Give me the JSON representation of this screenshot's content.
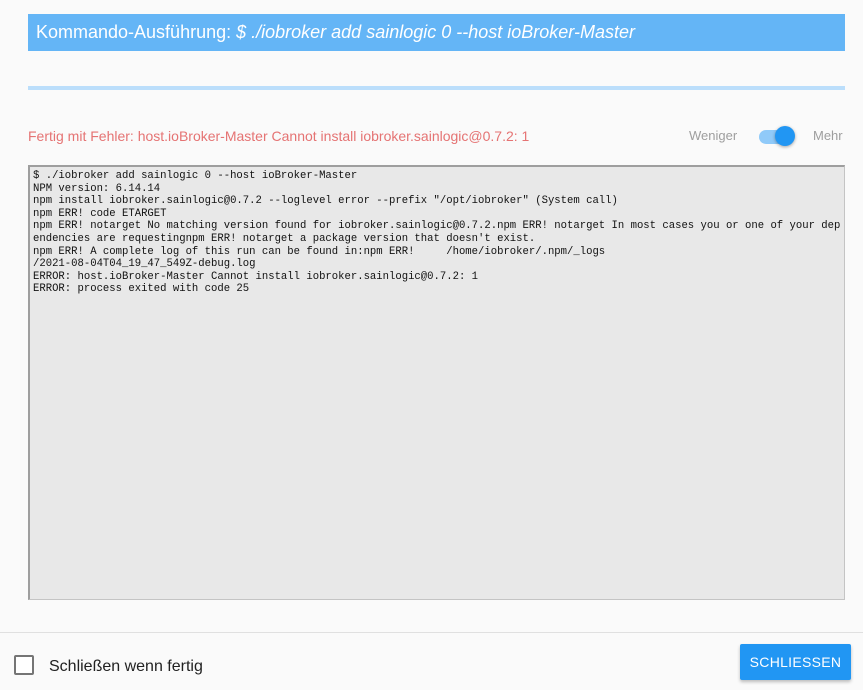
{
  "dialog": {
    "title_prefix": "Kommando-Ausführung: ",
    "title_command": "$ ./iobroker add sainlogic 0 --host ioBroker-Master",
    "progress": 1.0,
    "status": "Fertig mit Fehler: host.ioBroker-Master Cannot install iobroker.sainlogic@0.7.2: 1",
    "toggle": {
      "less_label": "Weniger",
      "more_label": "Mehr",
      "on": true
    },
    "log_lines": [
      "$ ./iobroker add sainlogic 0 --host ioBroker-Master",
      "NPM version: 6.14.14",
      "npm install iobroker.sainlogic@0.7.2 --loglevel error --prefix \"/opt/iobroker\" (System call)",
      "npm ERR! code ETARGET",
      "npm ERR! notarget No matching version found for iobroker.sainlogic@0.7.2.npm ERR! notarget In most cases you or one of your dependencies are requestingnpm ERR! notarget a package version that doesn't exist.",
      "npm ERR! A complete log of this run can be found in:npm ERR!     /home/iobroker/.npm/_logs",
      "/2021-08-04T04_19_47_549Z-debug.log",
      "ERROR: host.ioBroker-Master Cannot install iobroker.sainlogic@0.7.2: 1",
      "ERROR: process exited with code 25"
    ]
  },
  "footer": {
    "checkbox_label": "Schließen wenn fertig",
    "checkbox_checked": false,
    "close_label": "SCHLIESSEN"
  }
}
